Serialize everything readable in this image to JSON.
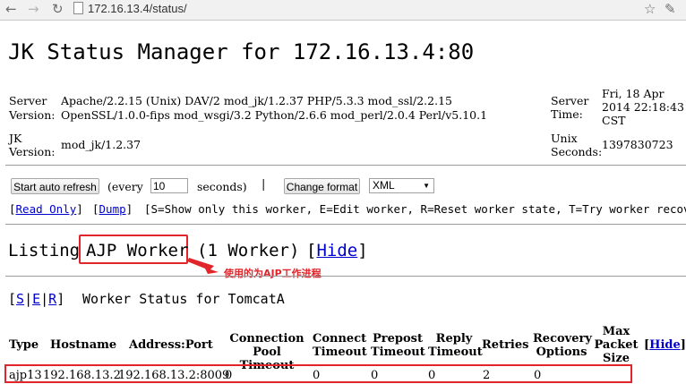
{
  "browser": {
    "url": "172.16.13.4/status/",
    "back_icon": "arrow-left-icon",
    "forward_icon": "arrow-right-icon",
    "reload_icon": "reload-icon",
    "star_icon": "star-icon",
    "menu_icon": "wrench-icon"
  },
  "header": {
    "title": "JK Status Manager for 172.16.13.4:80"
  },
  "server_info": {
    "server_label": "Server",
    "server_value": "Apache/2.2.15 (Unix) DAV/2 mod_jk/1.2.37 PHP/5.3.3 mod_ssl/2.2.15",
    "version_label": "Version:",
    "version_value": "OpenSSL/1.0.0-fips mod_wsgi/3.2 Python/2.6.6 mod_perl/2.0.4 Perl/v5.10.1",
    "jk_label_1": "JK",
    "jk_label_2": "Version:",
    "jk_value": "mod_jk/1.2.37",
    "time_label_1": "Server",
    "time_label_2": "Time:",
    "time_value_1": "Fri, 18 Apr",
    "time_value_2": "2014 22:18:43",
    "time_value_3": "CST",
    "unix_label_1": "Unix",
    "unix_label_2": "Seconds:",
    "unix_value": "1397830723"
  },
  "controls": {
    "auto_refresh_button": "Start auto refresh",
    "every_label": "(every",
    "every_value": "10",
    "seconds_label": "seconds)",
    "separator": "|",
    "change_format_button": "Change format",
    "format_selected": "XML"
  },
  "links": {
    "read_only_open": "[",
    "read_only": "Read Only",
    "read_only_close": "]",
    "dump_open": "[",
    "dump": "Dump",
    "dump_close": "]",
    "legend": "[S=Show only this worker, E=Edit worker, R=Reset worker state, T=Try worker recovery]"
  },
  "listing": {
    "prefix": "Listing",
    "worker_type": "AJP Worker",
    "count": "(1 Worker)",
    "hide_open": "[",
    "hide": "Hide",
    "hide_close": "]",
    "annotation": "使用的为AJP工作进程"
  },
  "worker": {
    "actions_open": "[",
    "s": "S",
    "sep1": "|",
    "e": "E",
    "sep2": "|",
    "r": "R",
    "actions_close": "]",
    "status_title": "Worker Status for TomcatA"
  },
  "table": {
    "headers": {
      "type": "Type",
      "hostname": "Hostname",
      "address": "Address:Port",
      "conn_timeout_1": "Connection",
      "conn_timeout_2": "Pool Timeout",
      "connect_timeout_1": "Connect",
      "connect_timeout_2": "Timeout",
      "prepost_1": "Prepost",
      "prepost_2": "Timeout",
      "reply_1": "Reply",
      "reply_2": "Timeout",
      "retries": "Retries",
      "recovery_1": "Recovery",
      "recovery_2": "Options",
      "max_1": "Max",
      "max_2": "Packet",
      "max_3": "Size",
      "hide_open": "[",
      "hide": "Hide",
      "hide_close": "]"
    },
    "row": {
      "type": "ajp13",
      "hostname": "192.168.13.2",
      "address": "192.168.13.2:8009",
      "conn_timeout": "0",
      "connect_timeout": "0",
      "prepost": "0",
      "reply": "0",
      "retries": "2",
      "recovery": "0"
    }
  },
  "colors": {
    "highlight_border": "#e0262b",
    "annotation_text": "#e0262b",
    "link": "#0000cc"
  }
}
